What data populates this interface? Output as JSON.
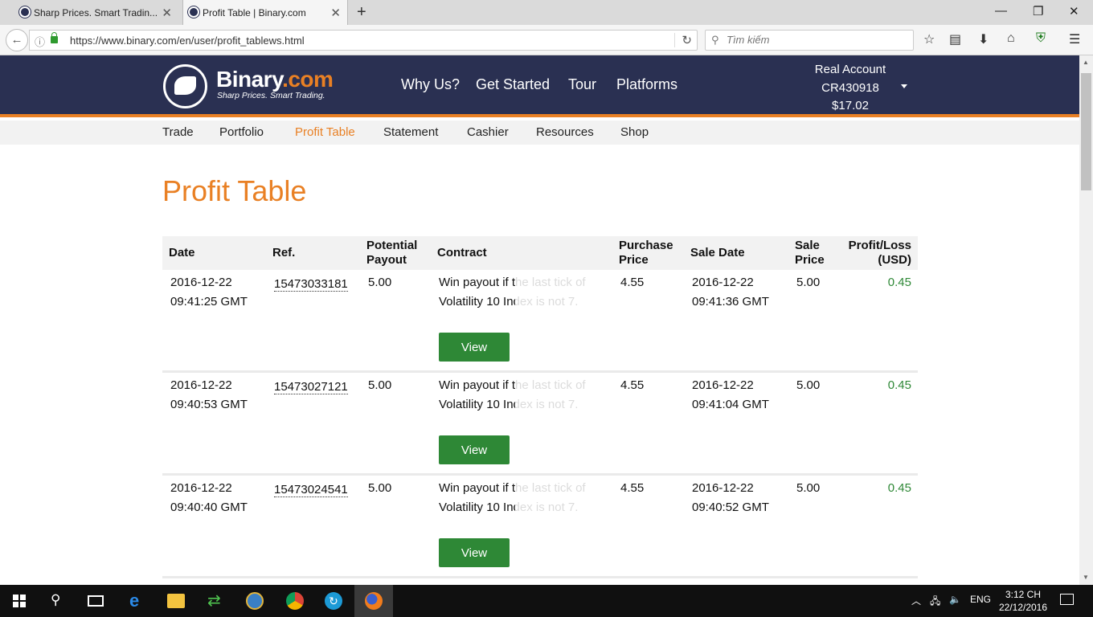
{
  "browser": {
    "tabs": [
      {
        "title": "Sharp Prices. Smart Tradin...",
        "active": false
      },
      {
        "title": "Profit Table | Binary.com",
        "active": true
      }
    ],
    "url": "https://www.binary.com/en/user/profit_tablews.html",
    "search_placeholder": "Tìm kiếm"
  },
  "site": {
    "logo_main": "Binary",
    "logo_suffix": ".com",
    "tagline": "Sharp Prices. Smart Trading.",
    "main_nav": [
      "Why Us?",
      "Get Started",
      "Tour",
      "Platforms"
    ],
    "account": {
      "type": "Real Account",
      "id": "CR430918",
      "balance": "$17.02"
    },
    "sub_nav": [
      "Trade",
      "Portfolio",
      "Profit Table",
      "Statement",
      "Cashier",
      "Resources",
      "Shop"
    ],
    "active_sub_nav": "Profit Table"
  },
  "page": {
    "title": "Profit Table",
    "columns": {
      "date": "Date",
      "ref": "Ref.",
      "potential_payout_1": "Potential",
      "potential_payout_2": "Payout",
      "contract": "Contract",
      "purchase_price_1": "Purchase",
      "purchase_price_2": "Price",
      "sale_date": "Sale Date",
      "sale_price_1": "Sale",
      "sale_price_2": "Price",
      "profit_loss_1": "Profit/Loss",
      "profit_loss_2": "(USD)"
    },
    "rows": [
      {
        "date": "2016-12-22",
        "time": "09:41:25 GMT",
        "ref": "15473033181",
        "payout": "5.00",
        "contract": "Win payout if the last tick of Volatility 10 Index is not 7.",
        "purchase": "4.55",
        "sale_date": "2016-12-22",
        "sale_time": "09:41:36 GMT",
        "sale_price": "5.00",
        "profit": "0.45",
        "view": "View"
      },
      {
        "date": "2016-12-22",
        "time": "09:40:53 GMT",
        "ref": "15473027121",
        "payout": "5.00",
        "contract": "Win payout if the last tick of Volatility 10 Index is not 7.",
        "purchase": "4.55",
        "sale_date": "2016-12-22",
        "sale_time": "09:41:04 GMT",
        "sale_price": "5.00",
        "profit": "0.45",
        "view": "View"
      },
      {
        "date": "2016-12-22",
        "time": "09:40:40 GMT",
        "ref": "15473024541",
        "payout": "5.00",
        "contract": "Win payout if the last tick of Volatility 10 Index is not 7.",
        "purchase": "4.55",
        "sale_date": "2016-12-22",
        "sale_time": "09:40:52 GMT",
        "sale_price": "5.00",
        "profit": "0.45",
        "view": "View"
      }
    ]
  },
  "taskbar": {
    "lang": "ENG",
    "time": "3:12 CH",
    "date": "22/12/2016"
  },
  "colors": {
    "header_bg": "#2a3052",
    "accent_orange": "#e98024",
    "button_green": "#2e8836",
    "profit_green": "#2e8836"
  }
}
